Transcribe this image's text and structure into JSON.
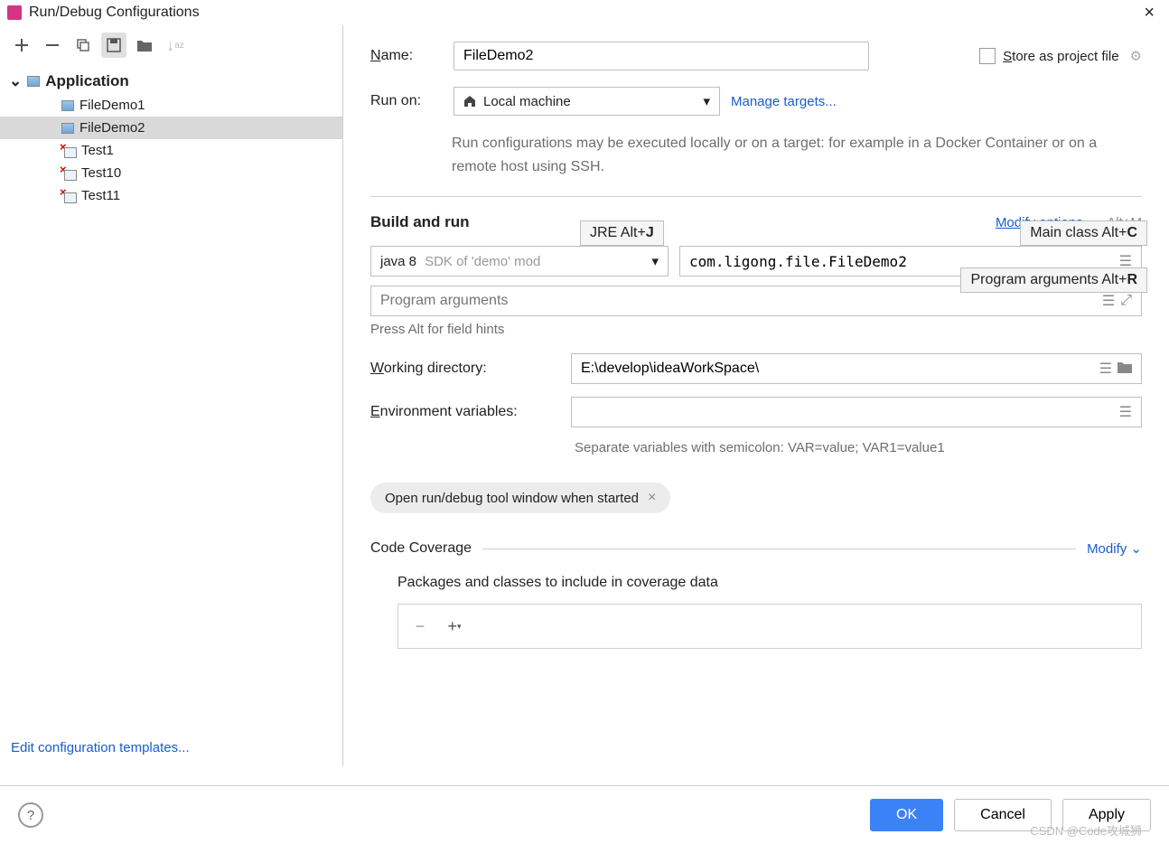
{
  "window": {
    "title": "Run/Debug Configurations"
  },
  "tree": {
    "root": "Application",
    "items": [
      "FileDemo1",
      "FileDemo2",
      "Test1",
      "Test10",
      "Test11"
    ],
    "selected": "FileDemo2"
  },
  "editTemplates": "Edit configuration templates...",
  "form": {
    "nameLabel": "Name:",
    "nameValue": "FileDemo2",
    "storeAs": "Store as project file",
    "runOnLabel": "Run on:",
    "runOnValue": "Local machine",
    "manageTargets": "Manage targets...",
    "runOnHint": "Run configurations may be executed locally or on a target: for example in a Docker Container or on a remote host using SSH.",
    "buildRun": "Build and run",
    "modifyOptions": "Modify options",
    "modifyShortcut": "Alt+M",
    "jreTooltip": "JRE Alt+J",
    "mainClassTooltip": "Main class Alt+C",
    "progArgsTooltip": "Program arguments Alt+R",
    "jreValue": "java 8",
    "jreSuffix": "SDK of 'demo' mod",
    "mainClassValue": "com.ligong.file.FileDemo2",
    "progArgsPlaceholder": "Program arguments",
    "altHint": "Press Alt for field hints",
    "workDirLabel": "Working directory:",
    "workDirValue": "E:\\develop\\ideaWorkSpace\\",
    "envLabel": "Environment variables:",
    "envValue": "",
    "envHint": "Separate variables with semicolon: VAR=value; VAR1=value1",
    "chip": "Open run/debug tool window when started",
    "coverage": "Code Coverage",
    "modify": "Modify",
    "covSub": "Packages and classes to include in coverage data"
  },
  "footer": {
    "ok": "OK",
    "cancel": "Cancel",
    "apply": "Apply"
  },
  "watermark": "CSDN @Code攻城狮"
}
